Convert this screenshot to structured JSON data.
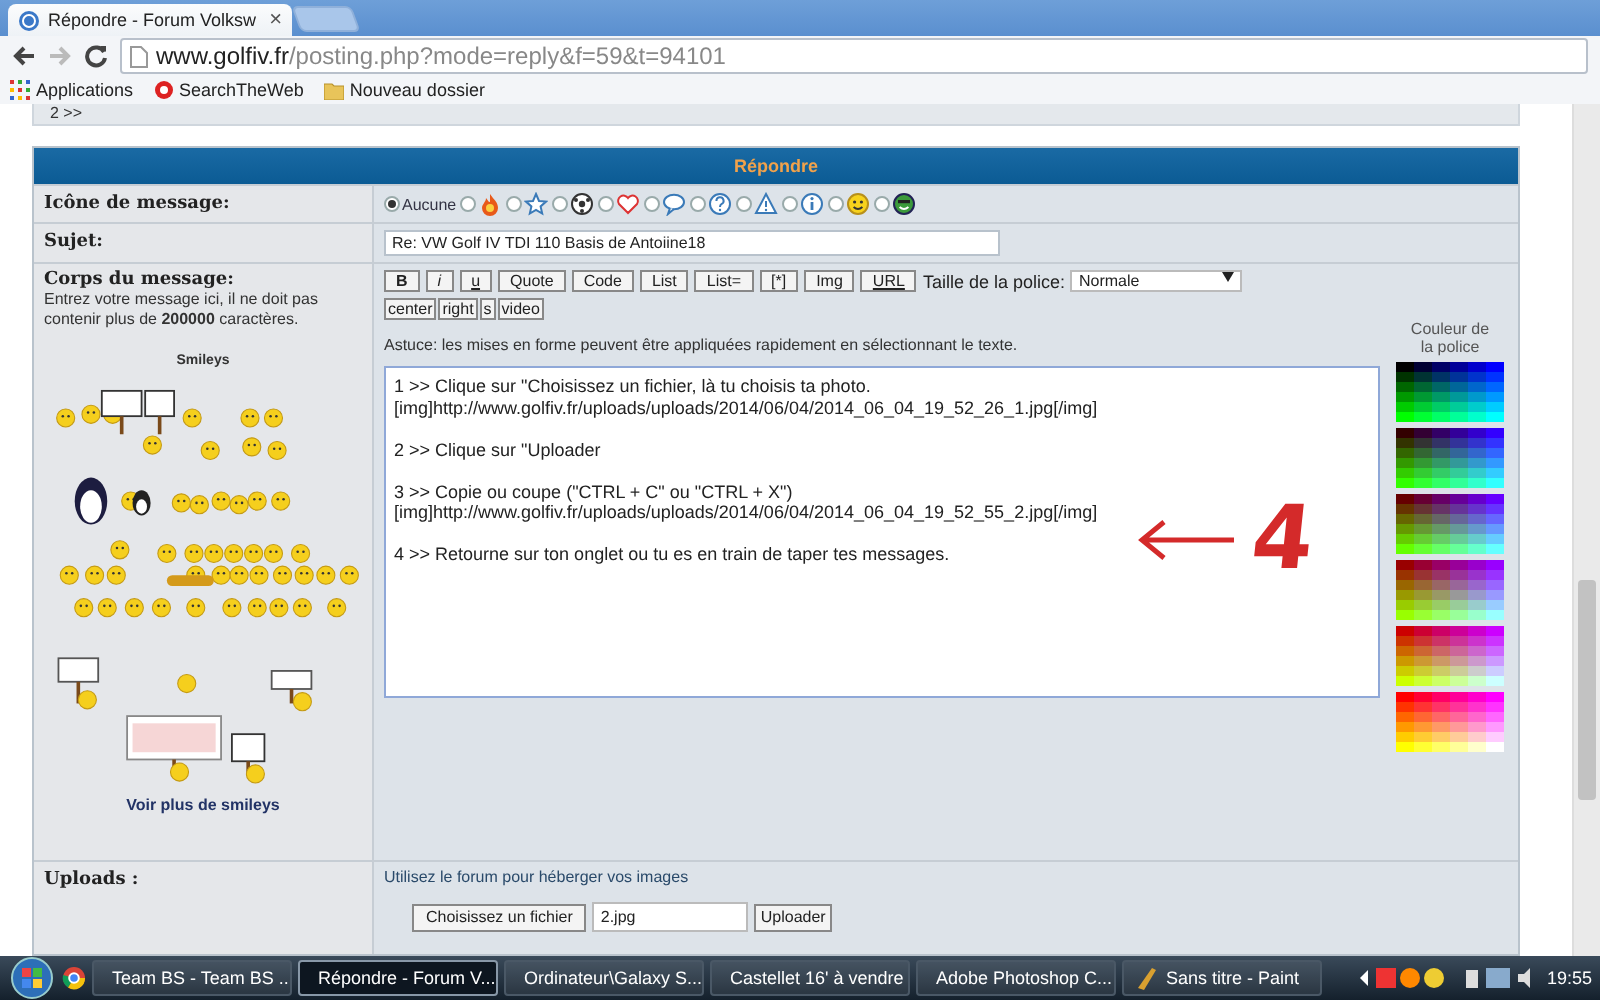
{
  "browser": {
    "tab_title": "Répondre - Forum Volksw",
    "tab_close": "×",
    "url": "**www.golfiv.fr**/posting.php?mode=reply&f=59&t=94101",
    "bookmarks": [
      {
        "kind": "apps",
        "label": "Applications"
      },
      {
        "kind": "search",
        "label": "SearchTheWeb"
      },
      {
        "kind": "folder",
        "label": "Nouveau dossier"
      }
    ]
  },
  "previous_post_fragment": "2 >>",
  "form": {
    "title": "Répondre",
    "message_icon": {
      "label": "Icône de message:",
      "options": [
        {
          "kind": "none",
          "label": "Aucune",
          "selected": true
        },
        {
          "kind": "flame",
          "selected": false
        },
        {
          "kind": "star",
          "selected": false
        },
        {
          "kind": "ball",
          "selected": false
        },
        {
          "kind": "heart",
          "selected": false
        },
        {
          "kind": "speech",
          "selected": false
        },
        {
          "kind": "question",
          "selected": false
        },
        {
          "kind": "warning",
          "selected": false
        },
        {
          "kind": "info",
          "selected": false
        },
        {
          "kind": "smiley",
          "selected": false
        },
        {
          "kind": "sunglasses-smiley",
          "selected": false
        }
      ]
    },
    "subject": {
      "label": "Sujet:",
      "value": "Re: VW Golf IV TDI 110 Basis de Antoiine18"
    },
    "body": {
      "label": "Corps du message:",
      "description": "Entrez votre message ici, il ne doit pas contenir plus de **200000** caractères.",
      "smileys_title": "Smileys",
      "more_smileys": "Voir plus de smileys",
      "format_buttons": [
        {
          "label": "B",
          "kind": "bold"
        },
        {
          "label": "i",
          "kind": "italic"
        },
        {
          "label": "u",
          "kind": "underline"
        },
        {
          "label": "Quote",
          "kind": "plain"
        },
        {
          "label": "Code",
          "kind": "plain"
        },
        {
          "label": "List",
          "kind": "plain"
        },
        {
          "label": "List=",
          "kind": "plain"
        },
        {
          "label": "[*]",
          "kind": "plain"
        },
        {
          "label": "Img",
          "kind": "plain"
        },
        {
          "label": "URL",
          "kind": "underline"
        }
      ],
      "font_size_label": "Taille de la police:",
      "font_size": "Normale",
      "extra_buttons": [
        "center",
        "right",
        "s",
        "video"
      ],
      "hint": "Astuce: les mises en forme peuvent être appliquées rapidement en sélectionnant le texte.",
      "color_label": "Couleur de la police",
      "message": "1 >> Clique sur \"Choisissez un fichier, là tu choisis ta photo.\n[img]http://www.golfiv.fr/uploads/uploads/2014/06/04/2014_06_04_19_52_26_1.jpg[/img]\n\n2 >> Clique sur \"Uploader\n\n3 >> Copie ou coupe (\"CTRL + C\" ou \"CTRL + X\")\n[img]http://www.golfiv.fr/uploads/uploads/2014/06/04/2014_06_04_19_52_55_2.jpg[/img]\n\n4 >> Retourne sur ton onglet ou tu es en train de taper tes messages.",
      "annotation": "4"
    },
    "uploads": {
      "label": "Uploads :",
      "hint": "Utilisez le forum pour héberger vos images",
      "file_button": "Choisissez un fichier",
      "file_name": "2.jpg",
      "upload_button": "Uploader"
    }
  },
  "taskbar": {
    "items": [
      {
        "kind": "chrome",
        "label": "Team BS - Team BS ...",
        "selected": false
      },
      {
        "kind": "chrome",
        "label": "Répondre - Forum V...",
        "selected": true
      },
      {
        "kind": "folder",
        "label": "Ordinateur\\Galaxy S...",
        "selected": false
      },
      {
        "kind": "folder",
        "label": "Castellet 16' à vendre",
        "selected": false
      },
      {
        "kind": "photoshop",
        "label": "Adobe Photoshop C...",
        "selected": false
      },
      {
        "kind": "paint",
        "label": "Sans titre - Paint",
        "selected": false
      }
    ],
    "clock": "19:55"
  }
}
